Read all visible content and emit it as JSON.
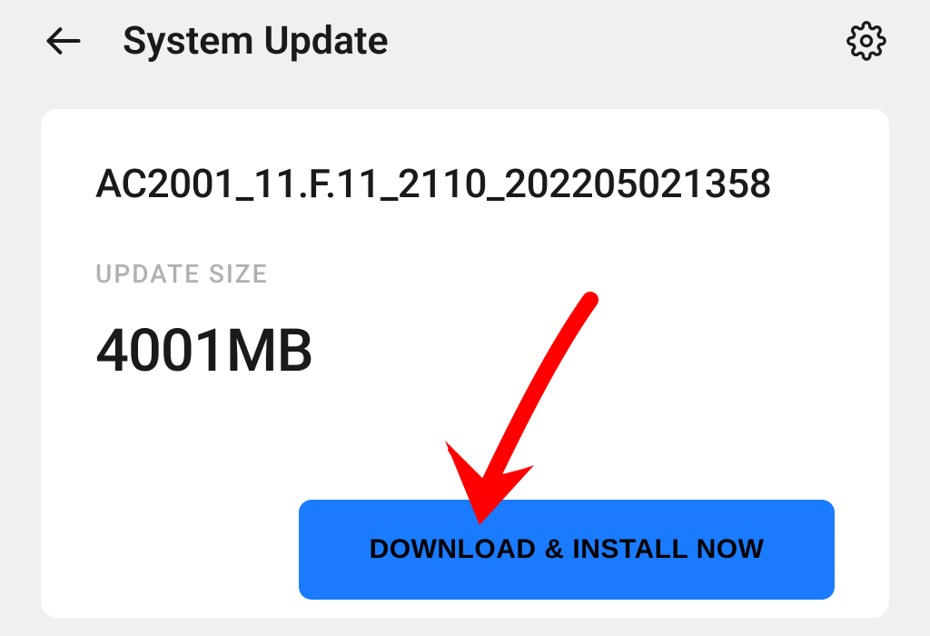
{
  "header": {
    "title": "System Update"
  },
  "update": {
    "build_version": "AC2001_11.F.11_2110_202205021358",
    "size_label": "UPDATE SIZE",
    "size_value": "4001MB"
  },
  "actions": {
    "download_label": "DOWNLOAD & INSTALL NOW"
  },
  "colors": {
    "accent": "#1a7bff",
    "annotation": "#ff0000"
  }
}
